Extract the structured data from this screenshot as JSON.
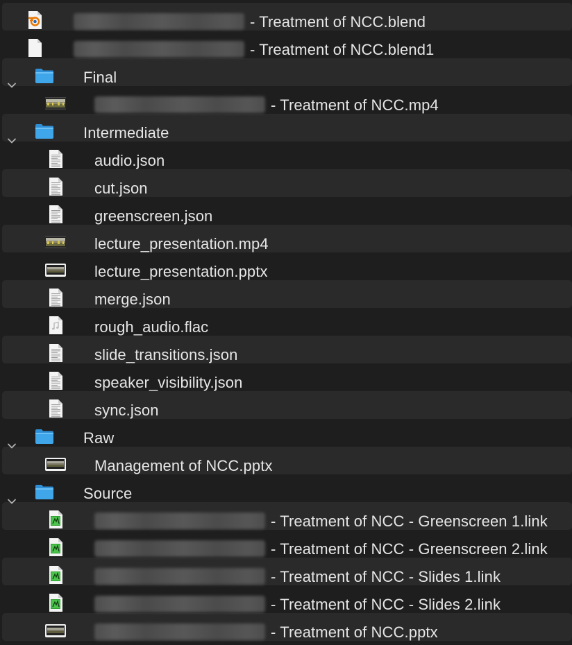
{
  "colors": {
    "background": "#1e1e1e",
    "stripe": "#2a2a2a",
    "text": "#e6e6e6",
    "folder": "#3fa6ea",
    "chevron": "#b3b3b3"
  },
  "rows": [
    {
      "id": "blend-file",
      "level": 0,
      "kind": "file",
      "icon": "blender-file-icon",
      "blurred": true,
      "label": "- Treatment of NCC.blend"
    },
    {
      "id": "blend1-file",
      "level": 0,
      "kind": "file",
      "icon": "blank-document-icon",
      "blurred": true,
      "label": "- Treatment of NCC.blend1"
    },
    {
      "id": "folder-final",
      "level": 0,
      "kind": "folder",
      "icon": "folder-icon",
      "blurred": false,
      "label": "Final"
    },
    {
      "id": "final-mp4",
      "level": 1,
      "kind": "file",
      "icon": "video-thumbnail-icon",
      "blurred": true,
      "label": "- Treatment of NCC.mp4"
    },
    {
      "id": "folder-intermediate",
      "level": 0,
      "kind": "folder",
      "icon": "folder-icon",
      "blurred": false,
      "label": "Intermediate"
    },
    {
      "id": "audio-json",
      "level": 1,
      "kind": "file",
      "icon": "text-document-icon",
      "blurred": false,
      "label": "audio.json"
    },
    {
      "id": "cut-json",
      "level": 1,
      "kind": "file",
      "icon": "text-document-icon",
      "blurred": false,
      "label": "cut.json"
    },
    {
      "id": "greenscreen-json",
      "level": 1,
      "kind": "file",
      "icon": "text-document-icon",
      "blurred": false,
      "label": "greenscreen.json"
    },
    {
      "id": "lecture-mp4",
      "level": 1,
      "kind": "file",
      "icon": "video-thumbnail-icon",
      "blurred": false,
      "label": "lecture_presentation.mp4"
    },
    {
      "id": "lecture-pptx",
      "level": 1,
      "kind": "file",
      "icon": "slides-thumbnail-icon",
      "blurred": false,
      "label": "lecture_presentation.pptx"
    },
    {
      "id": "merge-json",
      "level": 1,
      "kind": "file",
      "icon": "text-document-icon",
      "blurred": false,
      "label": "merge.json"
    },
    {
      "id": "rough-audio",
      "level": 1,
      "kind": "file",
      "icon": "audio-file-icon",
      "blurred": false,
      "label": "rough_audio.flac"
    },
    {
      "id": "slide-transitions",
      "level": 1,
      "kind": "file",
      "icon": "text-document-icon",
      "blurred": false,
      "label": "slide_transitions.json"
    },
    {
      "id": "speaker-visibility",
      "level": 1,
      "kind": "file",
      "icon": "text-document-icon",
      "blurred": false,
      "label": "speaker_visibility.json"
    },
    {
      "id": "sync-json",
      "level": 1,
      "kind": "file",
      "icon": "text-document-icon",
      "blurred": false,
      "label": "sync.json"
    },
    {
      "id": "folder-raw",
      "level": 0,
      "kind": "folder",
      "icon": "folder-icon",
      "blurred": false,
      "label": "Raw"
    },
    {
      "id": "management-pptx",
      "level": 1,
      "kind": "file",
      "icon": "slides-thumbnail-icon",
      "blurred": false,
      "label": "Management of NCC.pptx"
    },
    {
      "id": "folder-source",
      "level": 0,
      "kind": "folder",
      "icon": "folder-icon",
      "blurred": false,
      "label": "Source"
    },
    {
      "id": "greenscreen1-link",
      "level": 1,
      "kind": "file",
      "icon": "link-file-icon",
      "blurred": true,
      "label": "- Treatment of NCC - Greenscreen 1.link"
    },
    {
      "id": "greenscreen2-link",
      "level": 1,
      "kind": "file",
      "icon": "link-file-icon",
      "blurred": true,
      "label": "- Treatment of NCC - Greenscreen 2.link"
    },
    {
      "id": "slides1-link",
      "level": 1,
      "kind": "file",
      "icon": "link-file-icon",
      "blurred": true,
      "label": "- Treatment of NCC - Slides 1.link"
    },
    {
      "id": "slides2-link",
      "level": 1,
      "kind": "file",
      "icon": "link-file-icon",
      "blurred": true,
      "label": "- Treatment of NCC - Slides 2.link"
    },
    {
      "id": "source-pptx",
      "level": 1,
      "kind": "file",
      "icon": "slides-thumbnail-icon",
      "blurred": true,
      "label": "- Treatment of NCC.pptx"
    }
  ]
}
